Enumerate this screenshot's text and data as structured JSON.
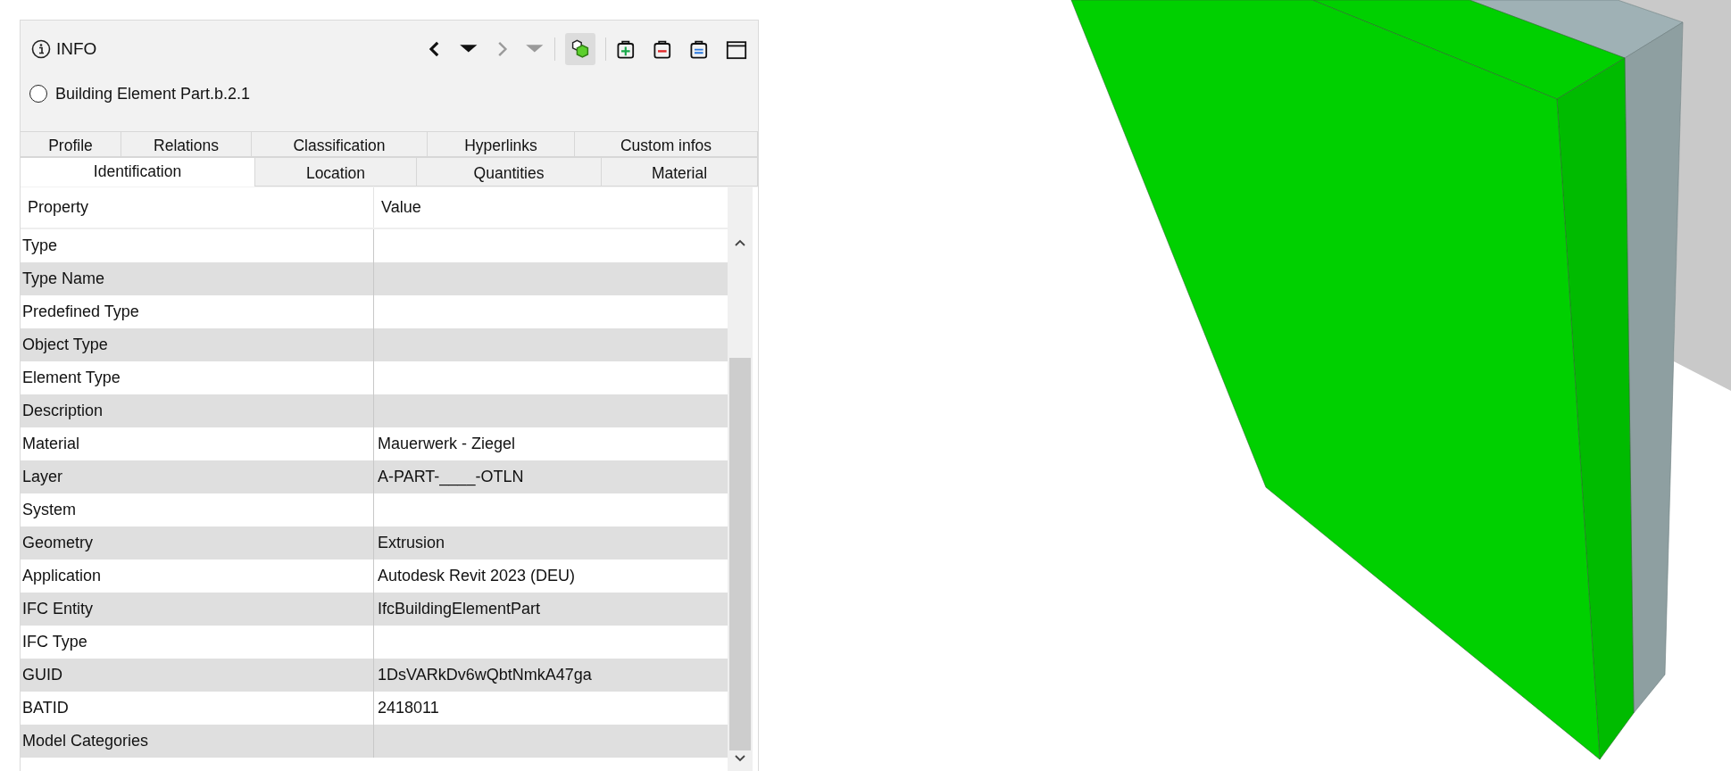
{
  "panel": {
    "title": "INFO"
  },
  "toolbar": [
    {
      "kind": "back",
      "disabled": false,
      "on": false
    },
    {
      "kind": "caret",
      "disabled": false,
      "on": false
    },
    {
      "kind": "forward",
      "disabled": true,
      "on": false
    },
    {
      "kind": "caret",
      "disabled": true,
      "on": false
    },
    {
      "kind": "isolate",
      "disabled": false,
      "on": true
    },
    {
      "kind": "clip-add",
      "disabled": false,
      "on": false
    },
    {
      "kind": "clip-remove",
      "disabled": false,
      "on": false
    },
    {
      "kind": "clip-equal",
      "disabled": false,
      "on": false
    },
    {
      "kind": "window",
      "disabled": false,
      "on": false
    }
  ],
  "object": {
    "name": "Building Element Part.b.2.1",
    "selected": false
  },
  "tab_rows": [
    [
      {
        "label": "Profile",
        "selected": false
      },
      {
        "label": "Relations",
        "selected": false
      },
      {
        "label": "Classification",
        "selected": false
      },
      {
        "label": "Hyperlinks",
        "selected": false
      },
      {
        "label": "Custom infos",
        "selected": false
      }
    ],
    [
      {
        "label": "Identification",
        "selected": true
      },
      {
        "label": "Location",
        "selected": false
      },
      {
        "label": "Quantities",
        "selected": false
      },
      {
        "label": "Material",
        "selected": false
      }
    ]
  ],
  "table": {
    "columns": [
      "Property",
      "Value"
    ],
    "rows": [
      {
        "property": "Type"
      },
      {
        "property": "Type Name"
      },
      {
        "property": "Predefined Type"
      },
      {
        "property": "Object Type"
      },
      {
        "property": "Element Type"
      },
      {
        "property": "Description"
      },
      {
        "property": "Material",
        "value": "Mauerwerk - Ziegel"
      },
      {
        "property": "Layer",
        "value": "A-PART-____-OTLN"
      },
      {
        "property": "System"
      },
      {
        "property": "Geometry",
        "value": "Extrusion"
      },
      {
        "property": "Application",
        "value": "Autodesk Revit 2023 (DEU)"
      },
      {
        "property": "IFC Entity",
        "value": "IfcBuildingElementPart"
      },
      {
        "property": "IFC Type"
      },
      {
        "property": "GUID",
        "value": "1DsVARkDv6wQbtNmkA47ga"
      },
      {
        "property": "BATID",
        "value": "2418011"
      },
      {
        "property": "Model Categories"
      }
    ]
  }
}
